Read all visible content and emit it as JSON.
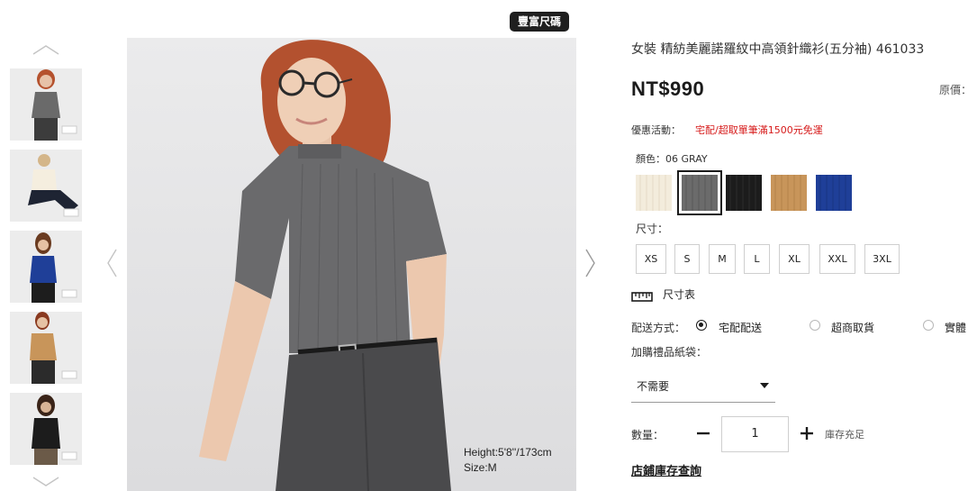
{
  "gallery": {
    "badge": "豐富尺碼",
    "model_info": [
      "Height:5'8''/173cm",
      "Size:M"
    ],
    "thumbnails": [
      {
        "name": "gray-knit"
      },
      {
        "name": "off-white-knit"
      },
      {
        "name": "blue-knit"
      },
      {
        "name": "yellow-knit"
      },
      {
        "name": "black-knit"
      }
    ]
  },
  "product": {
    "title": "女裝 精紡美麗諾羅紋中高領針織衫(五分袖) 461033",
    "price": "NT$990",
    "original_price_label": "原價："
  },
  "promo": {
    "label": "優惠活動：",
    "text": "宅配/超取單筆滿1500元免運"
  },
  "color": {
    "label": "顏色：06 GRAY",
    "swatches": [
      {
        "name": "off-white",
        "color": "#f3ecdc"
      },
      {
        "name": "gray",
        "color": "#6b6b6b",
        "selected": true
      },
      {
        "name": "black",
        "color": "#1c1c1c"
      },
      {
        "name": "yellow",
        "color": "#c8955a"
      },
      {
        "name": "blue",
        "color": "#1f3f98"
      }
    ]
  },
  "size": {
    "label": "尺寸：",
    "options": [
      "XS",
      "S",
      "M",
      "L",
      "XL",
      "XXL",
      "3XL"
    ],
    "chart_link": "尺寸表"
  },
  "shipping": {
    "label": "配送方式：",
    "options": [
      {
        "label": "宅配配送",
        "selected": true
      },
      {
        "label": "超商取貨",
        "selected": false
      },
      {
        "label": "實體",
        "selected": false
      }
    ]
  },
  "gift_bag": {
    "label": "加購禮品紙袋：",
    "selected": "不需要"
  },
  "quantity": {
    "label": "數量：",
    "value": "1",
    "stock": "庫存充足"
  },
  "store_link": "店鋪庫存查詢"
}
